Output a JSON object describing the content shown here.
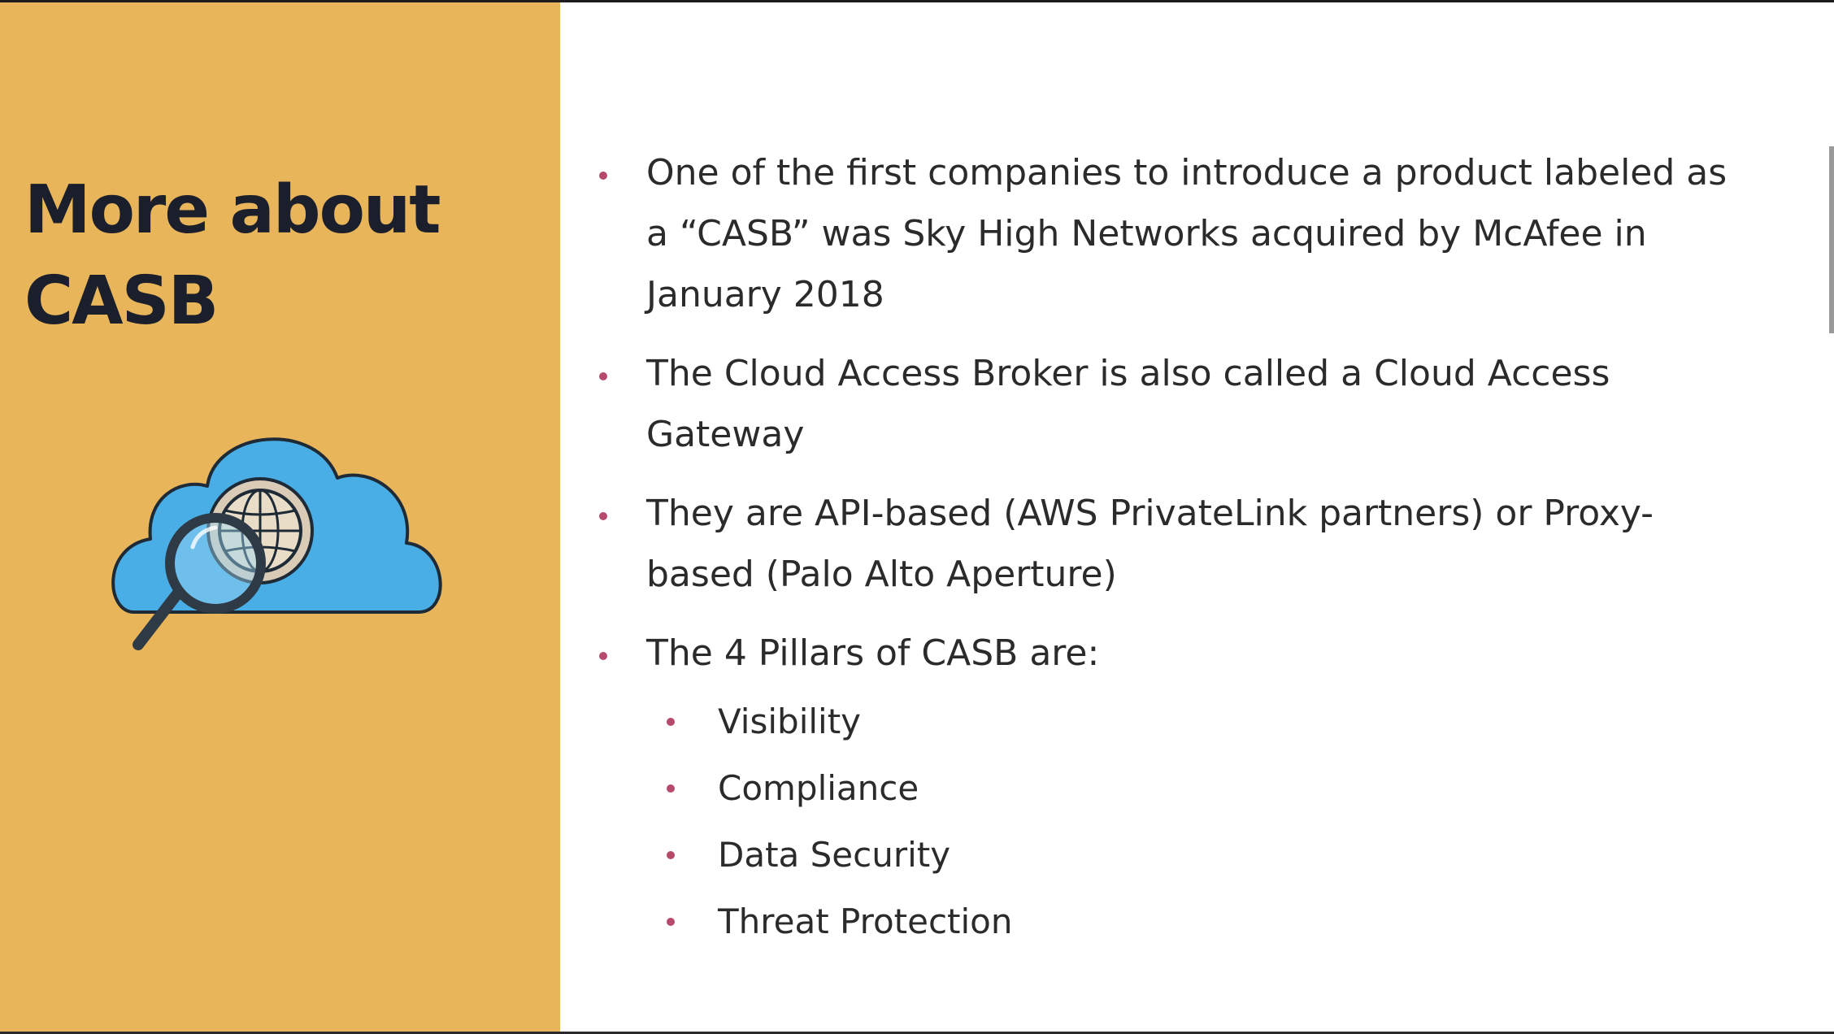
{
  "slide": {
    "title_line1": "More about",
    "title_line2": "CASB",
    "accent_color": "#e8b55b",
    "bullet_color": "#b54a6a",
    "illustration_icon": "cloud-globe-magnifier-icon",
    "bullets": [
      {
        "text": "One of the first companies to introduce a product labeled as a “CASB” was Sky High Networks acquired by McAfee in January 2018"
      },
      {
        "text": "The Cloud Access Broker is also called a Cloud Access Gateway"
      },
      {
        "text": "They are API-based (AWS PrivateLink partners) or Proxy-based (Palo Alto Aperture)"
      },
      {
        "text": "The 4 Pillars of CASB are:"
      }
    ],
    "pillars": [
      {
        "text": "Visibility"
      },
      {
        "text": "Compliance"
      },
      {
        "text": "Data Security"
      },
      {
        "text": "Threat Protection"
      }
    ]
  }
}
